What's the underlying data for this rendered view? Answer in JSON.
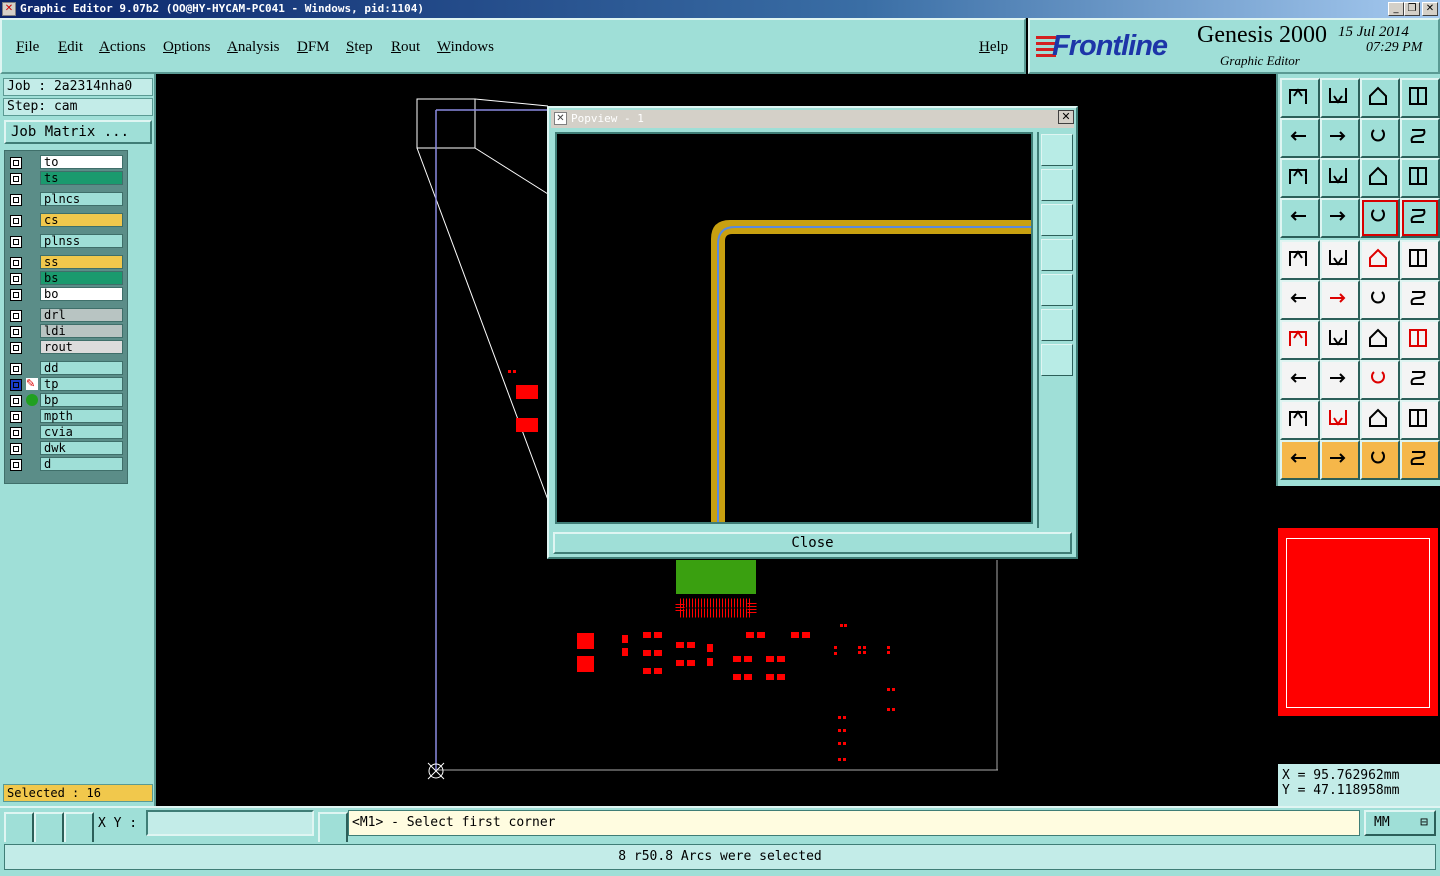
{
  "window": {
    "title": "Graphic Editor 9.07b2 (OO@HY-HYCAM-PC041 - Windows, pid:1104)",
    "minimize_icon": "minimize-icon",
    "maximize_icon": "maximize-icon",
    "close_icon": "close-icon"
  },
  "menu": {
    "items": [
      "File",
      "Edit",
      "Actions",
      "Options",
      "Analysis",
      "DFM",
      "Step",
      "Rout",
      "Windows"
    ],
    "help": "Help"
  },
  "brand": {
    "logo": "Frontline",
    "product": "Genesis 2000",
    "subtitle": "Graphic Editor",
    "date": "15 Jul 2014",
    "time": "07:29 PM"
  },
  "job": {
    "job_label": "Job : 2a2314nha0",
    "step_label": "Step: cam",
    "matrix_button": "Job Matrix ..."
  },
  "layers": [
    {
      "name": "to",
      "color": "#ffffff"
    },
    {
      "name": "ts",
      "color": "#1a9a6e"
    },
    {
      "name": "plncs",
      "color": "#9fdfd7"
    },
    {
      "name": "cs",
      "color": "#f1c84c"
    },
    {
      "name": "plnss",
      "color": "#9fdfd7"
    },
    {
      "name": "ss",
      "color": "#f1c84c"
    },
    {
      "name": "bs",
      "color": "#1a9a6e"
    },
    {
      "name": "bo",
      "color": "#ffffff"
    },
    {
      "name": "drl",
      "color": "#b8c4c2"
    },
    {
      "name": "ldi",
      "color": "#b8c4c2"
    },
    {
      "name": "rout",
      "color": "#dcdcdc"
    },
    {
      "name": "dd",
      "color": "#9fdfd7"
    },
    {
      "name": "tp",
      "color": "#9fdfd7"
    },
    {
      "name": "bp",
      "color": "#9fdfd7"
    },
    {
      "name": "mpth",
      "color": "#9fdfd7"
    },
    {
      "name": "cvia",
      "color": "#9fdfd7"
    },
    {
      "name": "dwk",
      "color": "#9fdfd7"
    },
    {
      "name": "d",
      "color": "#9fdfd7"
    }
  ],
  "selected_count": "Selected : 16",
  "popview": {
    "title": "Popview - 1",
    "close_button": "Close"
  },
  "coords": {
    "x": "X = 95.762962mm",
    "y": "Y = 47.118958mm"
  },
  "bottom": {
    "xy_label": "X Y :",
    "xy_value": "",
    "prompt": "<M1> - Select first corner",
    "units": "MM",
    "status": "8 r50.8 Arcs were selected"
  },
  "colors": {
    "panel": "#9fdfd7",
    "trace": "#c8a010",
    "pad": "#ff0000",
    "highlight": "#5a8adf"
  }
}
